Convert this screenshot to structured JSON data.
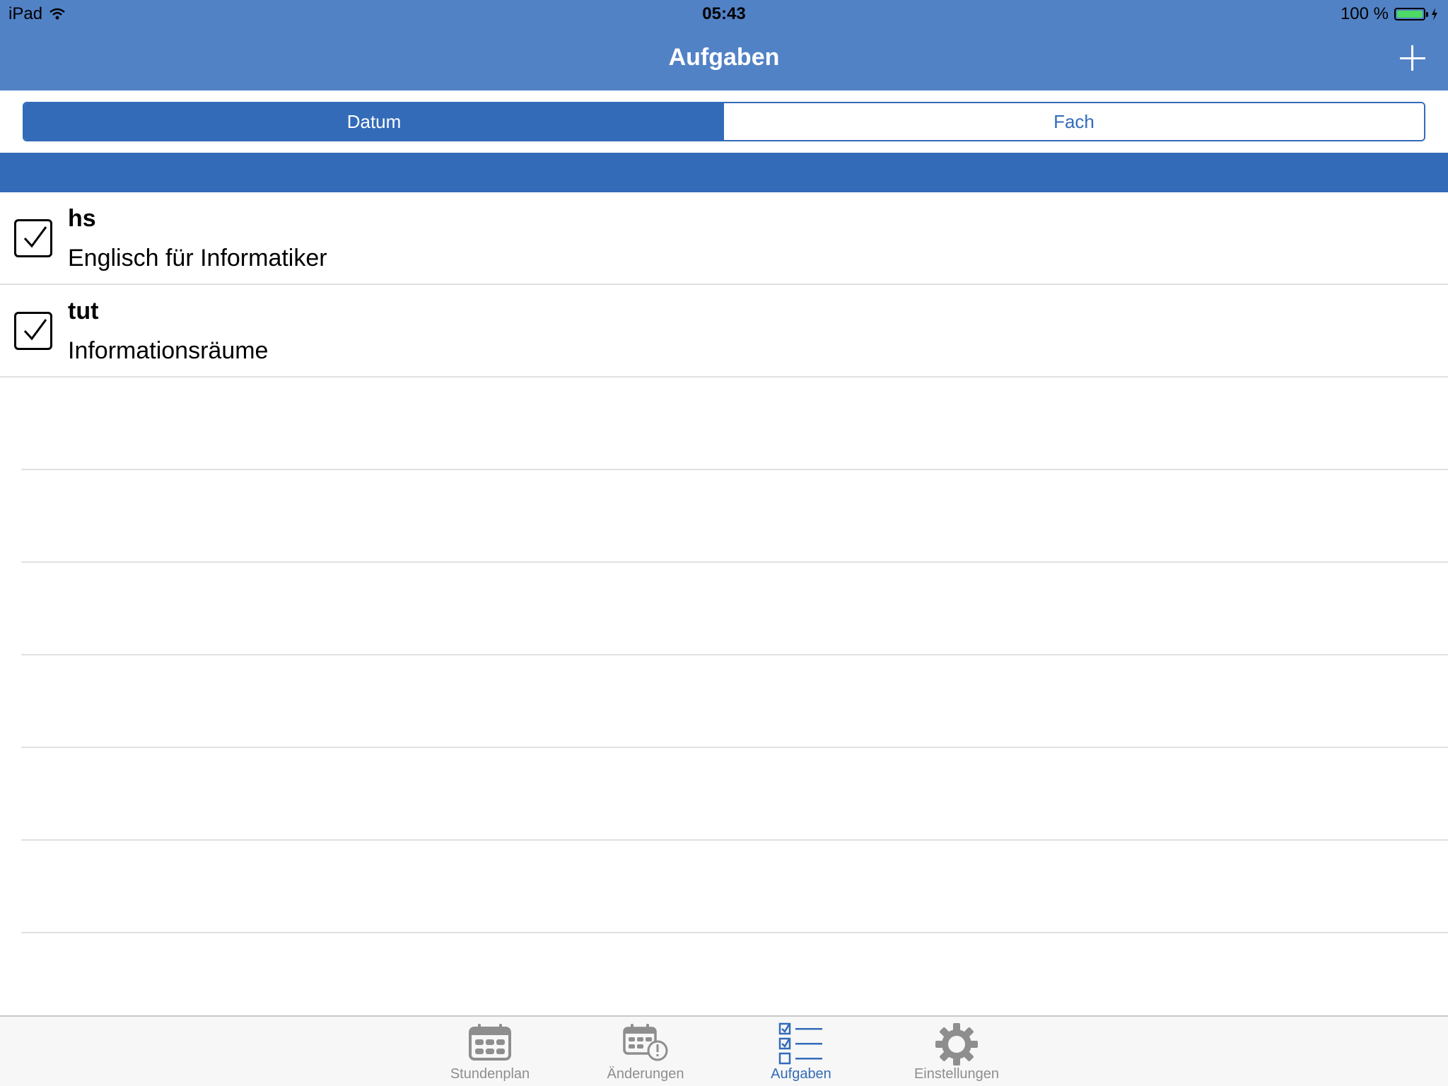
{
  "status_bar": {
    "device": "iPad",
    "time": "05:43",
    "battery_text": "100 %",
    "battery_level": 1.0
  },
  "nav": {
    "title": "Aufgaben",
    "add_icon": "plus-icon"
  },
  "segments": [
    {
      "label": "Datum",
      "selected": true
    },
    {
      "label": "Fach",
      "selected": false
    }
  ],
  "tasks": [
    {
      "title": "hs",
      "subject": "Englisch für Informatiker",
      "done": true
    },
    {
      "title": "tut",
      "subject": "Informationsräume",
      "done": true
    }
  ],
  "tabbar": {
    "items": [
      {
        "label": "Stundenplan",
        "icon": "calendar-icon",
        "active": false
      },
      {
        "label": "Änderungen",
        "icon": "calendar-alert-icon",
        "active": false
      },
      {
        "label": "Aufgaben",
        "icon": "checklist-icon",
        "active": true
      },
      {
        "label": "Einstellungen",
        "icon": "gear-icon",
        "active": false
      }
    ]
  },
  "colors": {
    "nav_bar": "#5282c6",
    "accent": "#336bb9",
    "battery": "#4cd964"
  }
}
